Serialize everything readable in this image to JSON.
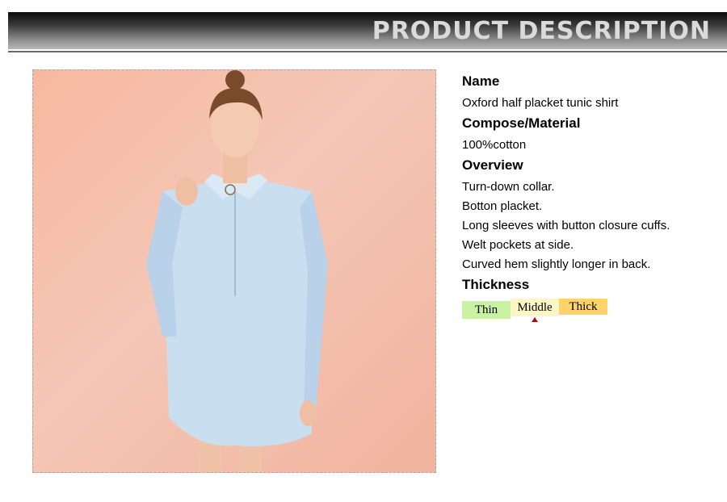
{
  "banner": {
    "title": "PRODUCT DESCRIPTION"
  },
  "photo": {
    "icon": "product-photo"
  },
  "description": {
    "name_label": "Name",
    "name_value": "Oxford half placket tunic shirt",
    "material_label": "Compose/Material",
    "material_value": "100%cotton",
    "overview_label": "Overview",
    "overview_items": [
      "Turn-down collar.",
      "Botton placket.",
      "Long sleeves with button closure cuffs.",
      "Welt pockets at side.",
      "Curved hem slightly longer in back."
    ],
    "thickness_label": "Thickness",
    "thickness_options": [
      "Thin",
      "Middle",
      "Thick"
    ],
    "thickness_selected": "Middle"
  },
  "colors": {
    "thin": "#c9f2a3",
    "middle": "#fff6c6",
    "thick": "#ffd36a",
    "marker": "#9b1111"
  }
}
